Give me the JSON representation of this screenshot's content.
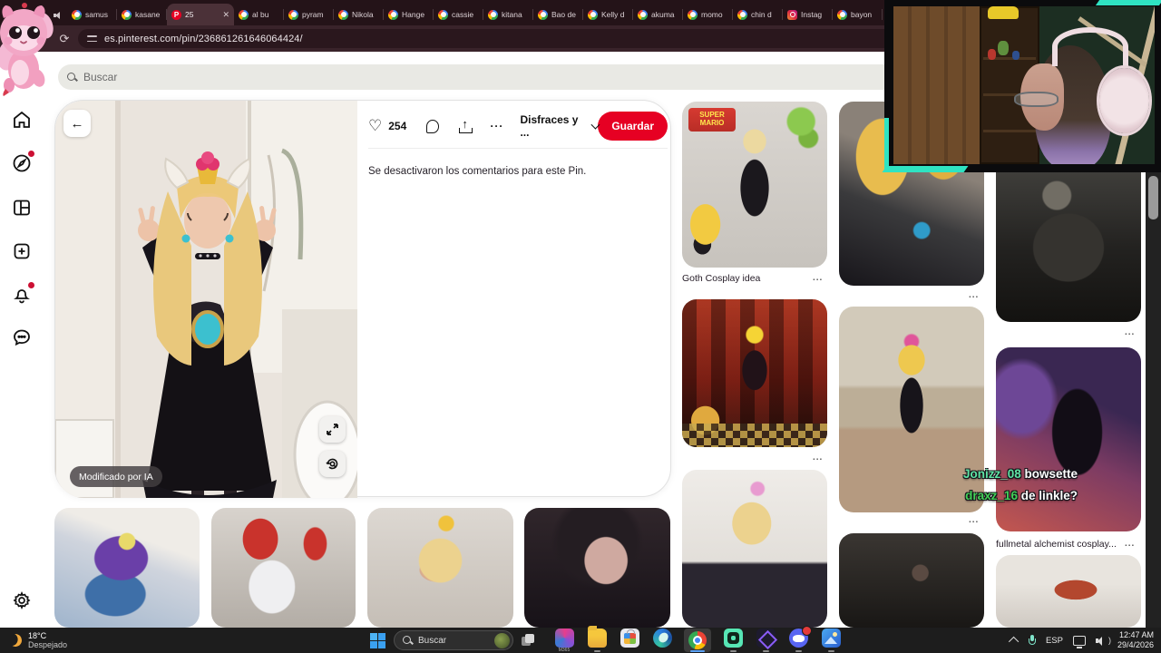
{
  "browser": {
    "url": "es.pinterest.com/pin/236861261646064424/",
    "tabs": [
      {
        "label": "samus",
        "icon": "google-favicon"
      },
      {
        "label": "kasane",
        "icon": "google-favicon"
      },
      {
        "label": "25",
        "icon": "pinterest-favicon",
        "active": true,
        "close": "✕"
      },
      {
        "label": "al bu",
        "icon": "google-favicon"
      },
      {
        "label": "pyram",
        "icon": "google-favicon"
      },
      {
        "label": "Nikola",
        "icon": "google-favicon"
      },
      {
        "label": "Hange",
        "icon": "google-favicon"
      },
      {
        "label": "cassie",
        "icon": "google-favicon"
      },
      {
        "label": "kitana",
        "icon": "google-favicon"
      },
      {
        "label": "Bao de",
        "icon": "google-favicon"
      },
      {
        "label": "Kelly d",
        "icon": "google-favicon"
      },
      {
        "label": "akuma",
        "icon": "google-favicon"
      },
      {
        "label": "momo",
        "icon": "google-favicon"
      },
      {
        "label": "chin d",
        "icon": "google-favicon"
      },
      {
        "label": "Instag",
        "icon": "instagram-favicon"
      },
      {
        "label": "bayon",
        "icon": "google-favicon"
      }
    ]
  },
  "icons": {
    "pinterest_glyph": "P",
    "back": "←",
    "reload": "⟳",
    "share_arrow": "↑",
    "heart": "♡",
    "ellipsis": "···",
    "volume_wave": ")"
  },
  "pinterest": {
    "search_placeholder": "Buscar",
    "pin": {
      "likes": "254",
      "board": "Disfraces y ...",
      "save_label": "Guardar",
      "comments_disabled": "Se desactivaron los comentarios para este Pin.",
      "ai_badge": "Modificado por IA"
    },
    "related": {
      "mario_logo": "SUPER MARIO",
      "caption_goth": "Goth Cosplay idea",
      "caption_fma": "fullmetal alchemist cosplay...",
      "more": "..."
    }
  },
  "chat": {
    "line1": {
      "user": "Jonizz_08",
      "message": "bowsette",
      "user_color": "#5fe3a4"
    },
    "line2": {
      "user": "draxz_16",
      "message": "de linkle?",
      "user_color": "#43cf57"
    }
  },
  "taskbar": {
    "weather": {
      "temp": "18°C",
      "condition": "Despejado"
    },
    "search_placeholder": "Buscar",
    "m365_label": "M365",
    "language": "ESP",
    "time": "12:47 AM",
    "date": "29/4/2026"
  },
  "colors": {
    "pinterest_red": "#e60023",
    "browser_chrome": "#39232a",
    "overlay_teal": "#2fe3c2",
    "chat_user1": "#5fe3a4",
    "chat_user2": "#43cf57"
  }
}
